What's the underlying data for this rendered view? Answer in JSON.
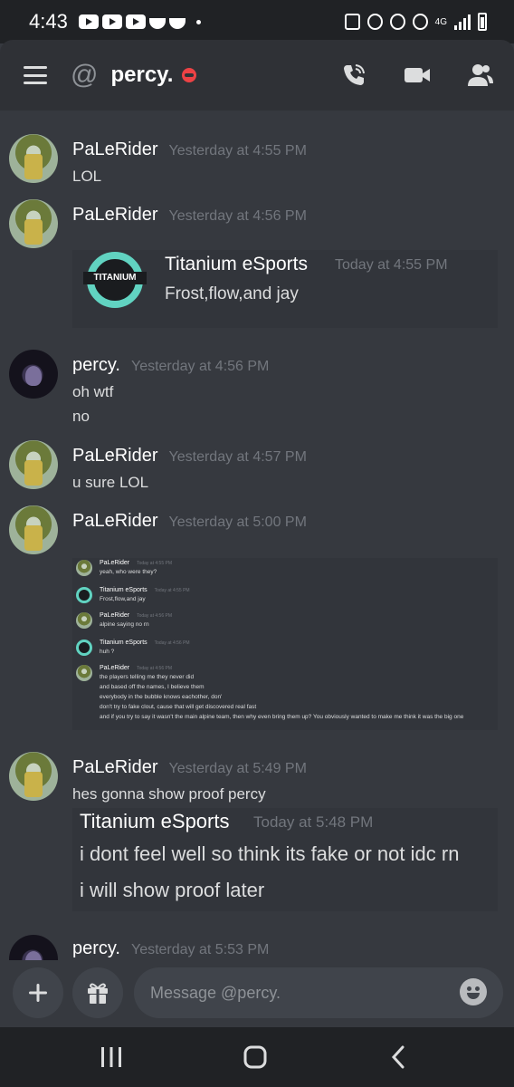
{
  "status_bar": {
    "time": "4:43",
    "network": "4G"
  },
  "header": {
    "at_symbol": "@",
    "title": "percy.",
    "status": "do-not-disturb",
    "icons": [
      "menu-icon",
      "call-icon",
      "video-icon",
      "members-icon"
    ]
  },
  "messages": [
    {
      "author": "PaLeRider",
      "timestamp": "Yesterday at 4:55 PM",
      "lines": [
        "LOL"
      ]
    },
    {
      "author": "PaLeRider",
      "timestamp": "Yesterday at 4:56 PM",
      "lines": [],
      "image_embed": {
        "author": "Titanium eSports",
        "timestamp": "Today at 4:55 PM",
        "text": "Frost,flow,and jay",
        "logo_text": "TITANIUM"
      }
    },
    {
      "author": "percy.",
      "timestamp": "Yesterday at 4:56 PM",
      "lines": [
        "oh wtf",
        "no"
      ]
    },
    {
      "author": "PaLeRider",
      "timestamp": "Yesterday at 4:57 PM",
      "lines": [
        "u sure LOL"
      ]
    },
    {
      "author": "PaLeRider",
      "timestamp": "Yesterday at 5:00 PM",
      "lines": [],
      "image_embed": {
        "messages": [
          {
            "author": "PaLeRider",
            "timestamp": "Today at 4:55 PM",
            "lines": [
              "yeah, who were they?"
            ]
          },
          {
            "author": "Titanium eSports",
            "timestamp": "Today at 4:55 PM",
            "lines": [
              "Frost,flow,and jay"
            ]
          },
          {
            "author": "PaLeRider",
            "timestamp": "Today at 4:56 PM",
            "lines": [
              "alpine saying no rn"
            ]
          },
          {
            "author": "Titanium eSports",
            "timestamp": "Today at 4:56 PM",
            "lines": [
              "huh ?"
            ]
          },
          {
            "author": "PaLeRider",
            "timestamp": "Today at 4:56 PM",
            "lines": [
              "the players telling me they never did",
              "and based off the names, I believe them",
              "everybody in the bubble knows eachother, don'",
              "don't try to fake clout, cause that will get discovered real fast",
              "and if you try to say it wasn't the main alpine team, then why even bring them up? You obviously wanted to make me think it was the big one"
            ]
          }
        ]
      }
    },
    {
      "author": "PaLeRider",
      "timestamp": "Yesterday at 5:49 PM",
      "lines": [
        "hes gonna show proof percy"
      ],
      "image_embed": {
        "author": "Titanium eSports",
        "timestamp": "Today at 5:48 PM",
        "lines": [
          "i dont feel well so think its fake or not idc rn",
          "i will show proof later"
        ]
      }
    },
    {
      "author": "percy.",
      "timestamp": "Yesterday at 5:53 PM",
      "lines": []
    }
  ],
  "composer": {
    "placeholder": "Message @percy."
  },
  "colors": {
    "background": "#36393f",
    "header": "#2f3136",
    "accent_dnd": "#ed4245",
    "titanium_teal": "#61d3c1"
  }
}
